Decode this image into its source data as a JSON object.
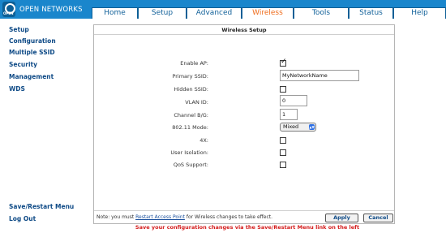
{
  "brand": {
    "name": "OPEN NETWORKS",
    "logo_text": "OPEN"
  },
  "tabs": [
    {
      "label": "Home"
    },
    {
      "label": "Setup"
    },
    {
      "label": "Advanced"
    },
    {
      "label": "Wireless"
    },
    {
      "label": "Tools"
    },
    {
      "label": "Status"
    },
    {
      "label": "Help"
    }
  ],
  "active_tab": "Wireless",
  "sidebar": {
    "items": [
      {
        "label": "Setup"
      },
      {
        "label": "Configuration"
      },
      {
        "label": "Multiple SSID"
      },
      {
        "label": "Security"
      },
      {
        "label": "Management"
      },
      {
        "label": "WDS"
      }
    ],
    "bottom": [
      {
        "label": "Save/Restart Menu"
      },
      {
        "label": "Log Out"
      }
    ]
  },
  "panel": {
    "title": "Wireless Setup",
    "fields": {
      "enable_ap": {
        "label": "Enable AP:",
        "checked": true
      },
      "primary_ssid": {
        "label": "Primary SSID:",
        "value": "MyNetworkName"
      },
      "hidden_ssid": {
        "label": "Hidden SSID:",
        "checked": false
      },
      "vlan_id": {
        "label": "VLAN ID:",
        "value": "0"
      },
      "channel_bg": {
        "label": "Channel B/G:",
        "value": "1"
      },
      "mode_80211": {
        "label": "802.11 Mode:",
        "value": "Mixed"
      },
      "fourx": {
        "label": "4X:",
        "checked": false
      },
      "user_isolation": {
        "label": "User Isolation:",
        "checked": false
      },
      "qos_support": {
        "label": "QoS Support:",
        "checked": false
      }
    },
    "note_prefix": "Note: you must ",
    "note_link": "Restart Access Point",
    "note_suffix": " for Wireless changes to take effect.",
    "apply_label": "Apply",
    "cancel_label": "Cancel"
  },
  "footer": {
    "message": "Save your configuration changes via the Save/Restart Menu link on the left"
  },
  "colors": {
    "header_blue": "#1a86cc",
    "tab_text": "#0f5f98",
    "active_tab_text": "#ee6b1a",
    "sidebar_link": "#0e4a86",
    "footer_red": "#d41c1c"
  }
}
